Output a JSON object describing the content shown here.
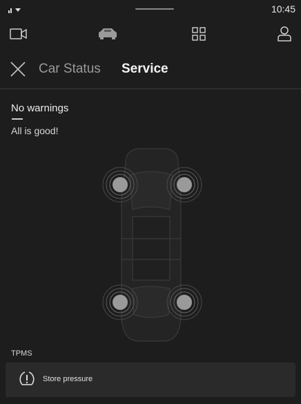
{
  "status_bar": {
    "time": "10:45"
  },
  "top_nav": {
    "icons": [
      "camera-icon",
      "car-icon",
      "apps-grid-icon",
      "profile-icon"
    ]
  },
  "header": {
    "tabs": [
      {
        "label": "Car Status"
      },
      {
        "label": "Service"
      }
    ]
  },
  "status": {
    "title": "No warnings",
    "subtitle": "All is good!"
  },
  "tpms": {
    "section_label": "TPMS",
    "action_label": "Store pressure"
  },
  "colors": {
    "background": "#1d1d1d",
    "panel": "#2a2a2a",
    "tire": "#9a9a9a"
  }
}
